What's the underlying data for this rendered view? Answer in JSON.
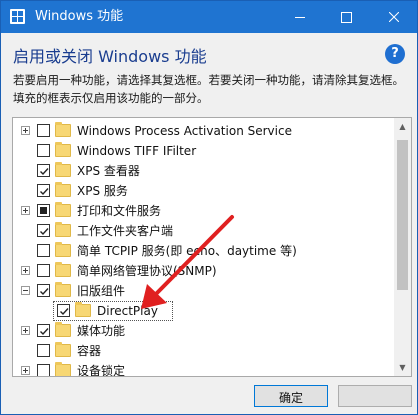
{
  "window": {
    "title": "Windows 功能",
    "accent": "#1f74d1"
  },
  "dialog": {
    "heading": "启用或关闭 Windows 功能",
    "help_glyph": "?",
    "description": "若要启用一种功能，请选择其复选框。若要关闭一种功能，请清除其复选框。填充的框表示仅启用该功能的一部分。"
  },
  "features": [
    {
      "label": "Windows Process Activation Service",
      "expander": "plus",
      "state": "unchecked",
      "level": 0
    },
    {
      "label": "Windows TIFF IFilter",
      "expander": "none",
      "state": "unchecked",
      "level": 0
    },
    {
      "label": "XPS 查看器",
      "expander": "none",
      "state": "checked",
      "level": 0
    },
    {
      "label": "XPS 服务",
      "expander": "none",
      "state": "checked",
      "level": 0
    },
    {
      "label": "打印和文件服务",
      "expander": "plus",
      "state": "partial",
      "level": 0
    },
    {
      "label": "工作文件夹客户端",
      "expander": "none",
      "state": "checked",
      "level": 0
    },
    {
      "label": "简单 TCPIP 服务(即 echo、daytime 等)",
      "expander": "none",
      "state": "unchecked",
      "level": 0
    },
    {
      "label": "简单网络管理协议(SNMP)",
      "expander": "plus",
      "state": "unchecked",
      "level": 0
    },
    {
      "label": "旧版组件",
      "expander": "minus",
      "state": "checked",
      "level": 0
    },
    {
      "label": "DirectPlay",
      "expander": "none",
      "state": "checked",
      "level": 1
    },
    {
      "label": "媒体功能",
      "expander": "plus",
      "state": "checked",
      "level": 0
    },
    {
      "label": "容器",
      "expander": "none",
      "state": "unchecked",
      "level": 0
    },
    {
      "label": "设备锁定",
      "expander": "plus",
      "state": "unchecked",
      "level": 0
    }
  ],
  "buttons": {
    "ok": "确定"
  },
  "icons": {
    "app": "windows-features-icon",
    "help": "help-icon",
    "folder": "folder-icon"
  },
  "colors": {
    "heading": "#1a3d8f",
    "arrow": "#e02020",
    "folder": "#f7d774"
  }
}
